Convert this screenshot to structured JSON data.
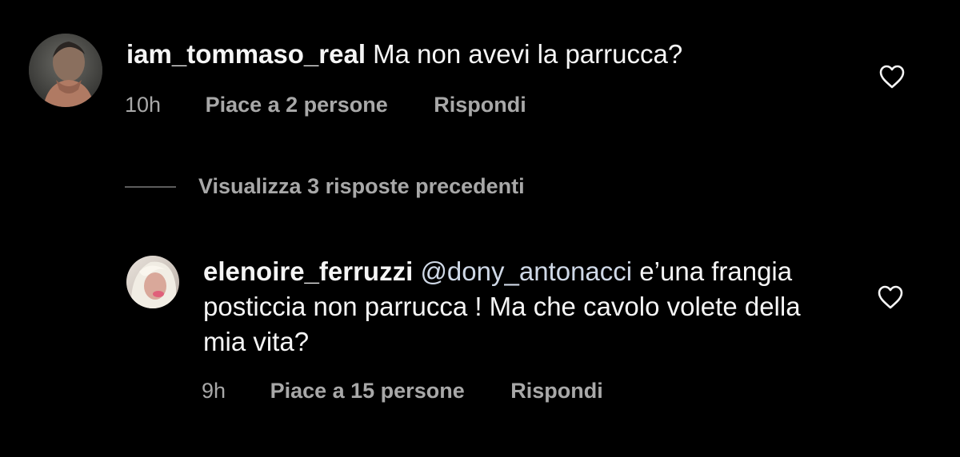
{
  "comments": [
    {
      "username": "iam_tommaso_real",
      "text": "Ma non avevi la parrucca?",
      "time": "10h",
      "likes": "Piace a 2 persone",
      "reply_label": "Rispondi",
      "avatar_icon": "user-avatar-photo",
      "like_icon": "heart-outline-icon"
    },
    {
      "username": "elenoire_ferruzzi",
      "mention": "@dony_antonacci",
      "text": "e’una frangia posticcia non parrucca ! Ma che cavolo volete della mia vita?",
      "time": "9h",
      "likes": "Piace a 15 persone",
      "reply_label": "Rispondi",
      "avatar_icon": "user-avatar-photo",
      "like_icon": "heart-outline-icon"
    }
  ],
  "view_replies": {
    "label": "Visualizza 3 risposte precedenti"
  },
  "colors": {
    "background": "#000000",
    "primary_text": "#f5f5f5",
    "secondary_text": "#a8a8a8",
    "mention": "#cfd8e6"
  }
}
